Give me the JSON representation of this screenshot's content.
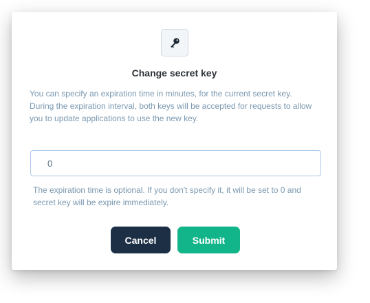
{
  "dialog": {
    "icon": "key-icon",
    "title": "Change secret key",
    "description_line1": "You can specify an expiration time in minutes, for the current secret key.",
    "description_line2": "During the expiration interval, both keys will be accepted for requests to allow you to update applications to use the new key.",
    "expiration_input": {
      "value": "0"
    },
    "helper_text": "The expiration time is optional. If you don't specify it, it will be set to 0 and secret key will be expire immediately.",
    "cancel_label": "Cancel",
    "submit_label": "Submit"
  },
  "colors": {
    "cancel_button": "#1c2f45",
    "submit_button": "#12b58a",
    "description_text": "#7a98b0",
    "title_text": "#2e3338",
    "input_border": "#a9c7e6"
  }
}
